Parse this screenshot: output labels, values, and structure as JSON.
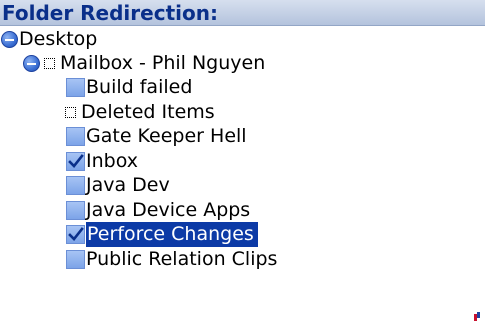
{
  "header": {
    "title": "Folder Redirection:"
  },
  "tree": {
    "root": {
      "label": "Desktop",
      "expander_icon": "collapse-minus-icon"
    },
    "mailbox": {
      "label": "Mailbox - Phil Nguyen",
      "expander_icon": "collapse-minus-icon"
    },
    "folders": [
      {
        "label": "Build failed",
        "checked": false,
        "box": "checkbox"
      },
      {
        "label": "Deleted Items",
        "checked": false,
        "box": "dotted"
      },
      {
        "label": "Gate Keeper Hell",
        "checked": false,
        "box": "checkbox"
      },
      {
        "label": "Inbox",
        "checked": true,
        "box": "checkbox"
      },
      {
        "label": "Java Dev",
        "checked": false,
        "box": "checkbox"
      },
      {
        "label": "Java Device Apps",
        "checked": false,
        "box": "checkbox"
      },
      {
        "label": "Perforce Changes",
        "checked": true,
        "box": "checkbox",
        "selected": true
      },
      {
        "label": "Public Relation Clips",
        "checked": false,
        "box": "checkbox"
      }
    ]
  },
  "colors": {
    "title_text": "#0a2f8a",
    "selection_bg": "#0c3aa6",
    "checkbox_fill": "#8fb0ee",
    "check_mark": "#0a2f8a"
  }
}
